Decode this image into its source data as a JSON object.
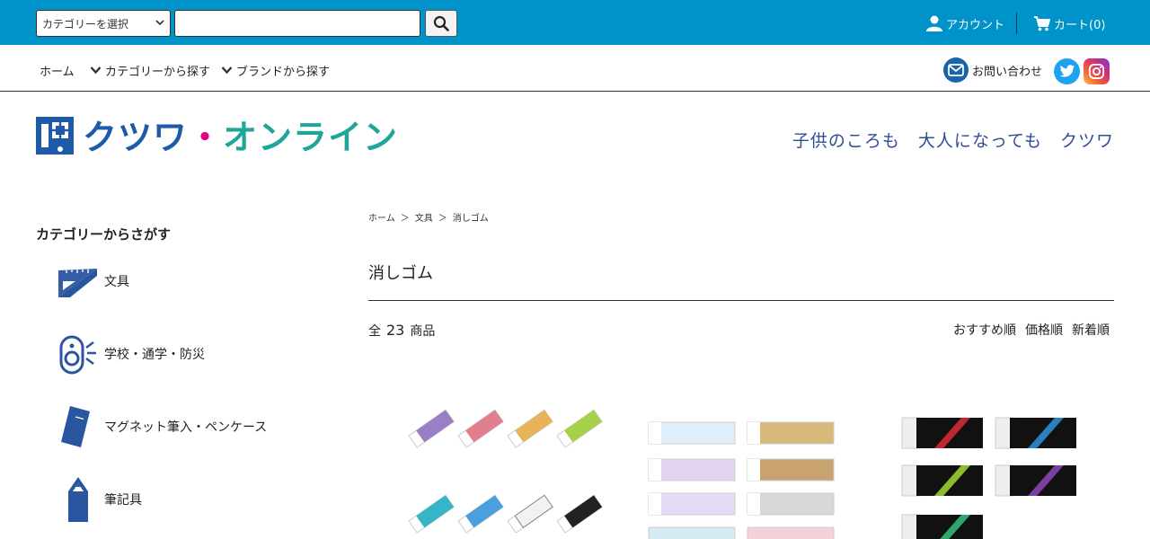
{
  "topbar": {
    "category_select": "カテゴリーを選択",
    "search_placeholder": "",
    "account_label": "アカウント",
    "cart_label": "カート(0)"
  },
  "nav": {
    "home": "ホーム",
    "by_category": "カテゴリーから探す",
    "by_brand": "ブランドから探す",
    "contact": "お問い合わせ"
  },
  "header": {
    "logo_text_blue": "クツワ",
    "logo_dot": "・",
    "logo_text_teal": "オンライン",
    "tagline": "子供のころも　大人になっても　クツワ"
  },
  "sidebar": {
    "title": "カテゴリーからさがす",
    "items": [
      {
        "label": "文具",
        "icon": "ruler-triangle-icon"
      },
      {
        "label": "学校・通学・防災",
        "icon": "alarm-buzzer-icon"
      },
      {
        "label": "マグネット筆入・ペンケース",
        "icon": "pencase-icon"
      },
      {
        "label": "筆記具",
        "icon": "pencil-icon"
      }
    ]
  },
  "main": {
    "breadcrumb": [
      "ホーム",
      "＞",
      "文具",
      "＞",
      "消しゴム"
    ],
    "page_title": "消しゴム",
    "count_prefix": "全",
    "count_value": "23",
    "count_suffix": "商品",
    "sort_options": [
      "おすすめ順",
      "価格順",
      "新着順"
    ]
  },
  "colors": {
    "topbar": "#0093c9",
    "logo_blue": "#1d5aa8",
    "logo_teal": "#1fa69a",
    "logo_dot": "#e4007f",
    "tagline": "#2f4f95"
  }
}
